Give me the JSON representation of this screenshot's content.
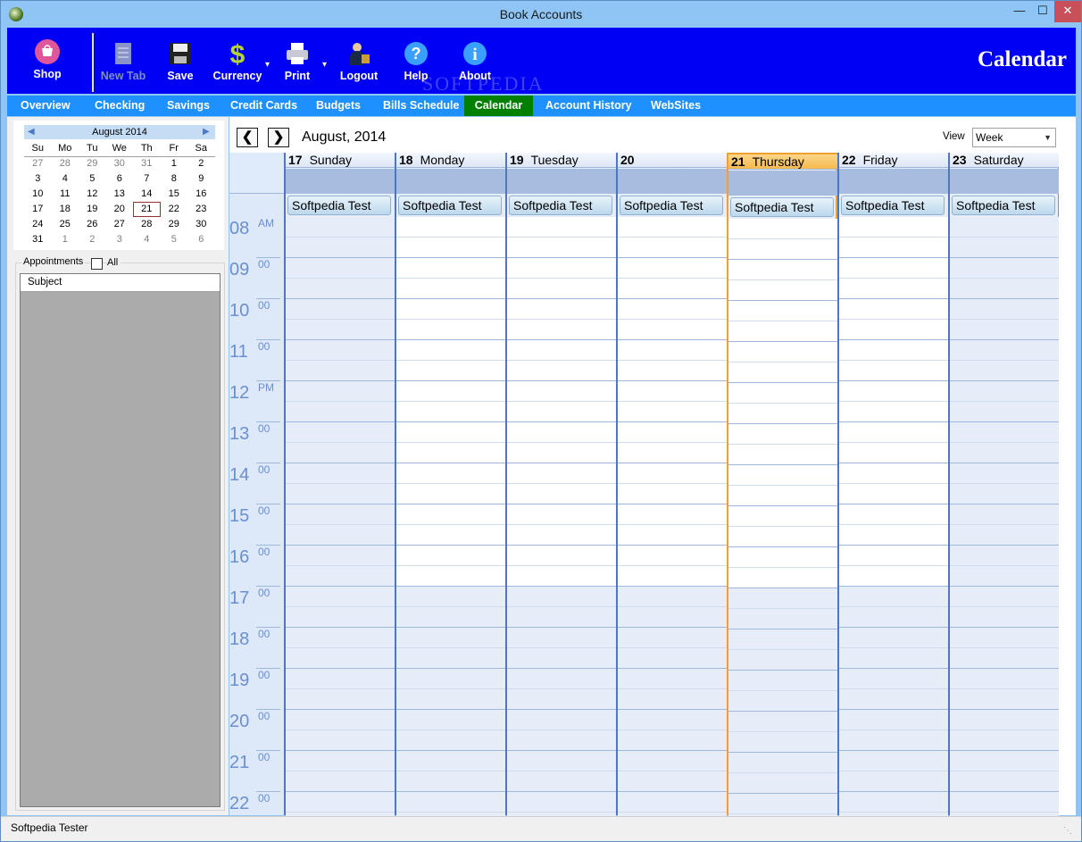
{
  "window": {
    "title": "Book Accounts"
  },
  "toolbar": {
    "items": [
      {
        "label": "Shop",
        "icon": "shop-icon"
      },
      {
        "label": "New Tab",
        "icon": "new-tab-icon",
        "disabled": true
      },
      {
        "label": "Save",
        "icon": "save-disk-icon"
      },
      {
        "label": "Currency",
        "icon": "dollar-sign-icon"
      },
      {
        "label": "Print",
        "icon": "printer-icon"
      },
      {
        "label": "Logout",
        "icon": "logout-person-icon"
      },
      {
        "label": "Help",
        "icon": "help-question-icon"
      },
      {
        "label": "About",
        "icon": "about-info-icon"
      }
    ],
    "heading": "Calendar",
    "watermark": "SOFTPEDIA"
  },
  "nav": {
    "items": [
      "Overview",
      "Checking",
      "Savings",
      "Credit Cards",
      "Budgets",
      "Bills Schedule",
      "Calendar",
      "Account History",
      "WebSites"
    ],
    "active": "Calendar"
  },
  "mini_calendar": {
    "month": "August 2014",
    "weekdays": [
      "Su",
      "Mo",
      "Tu",
      "We",
      "Th",
      "Fr",
      "Sa"
    ],
    "weeks": [
      [
        "27",
        "28",
        "29",
        "30",
        "31",
        "1",
        "2"
      ],
      [
        "3",
        "4",
        "5",
        "6",
        "7",
        "8",
        "9"
      ],
      [
        "10",
        "11",
        "12",
        "13",
        "14",
        "15",
        "16"
      ],
      [
        "17",
        "18",
        "19",
        "20",
        "21",
        "22",
        "23"
      ],
      [
        "24",
        "25",
        "26",
        "27",
        "28",
        "29",
        "30"
      ],
      [
        "31",
        "1",
        "2",
        "3",
        "4",
        "5",
        "6"
      ]
    ],
    "selected": "21"
  },
  "appointments": {
    "label": "Appointments",
    "all_label": "All",
    "column": "Subject"
  },
  "calendar": {
    "month_title": "August, 2014",
    "view_label": "View",
    "view_value": "Week",
    "days": [
      {
        "num": "17",
        "name": "Sunday",
        "event": "Softpedia Test"
      },
      {
        "num": "18",
        "name": "Monday",
        "event": "Softpedia Test"
      },
      {
        "num": "19",
        "name": "Tuesday",
        "event": "Softpedia Test"
      },
      {
        "num": "20",
        "name": "",
        "event": "Softpedia Test"
      },
      {
        "num": "21",
        "name": "Thursday",
        "event": "Softpedia Test"
      },
      {
        "num": "22",
        "name": "Friday",
        "event": "Softpedia Test"
      },
      {
        "num": "23",
        "name": "Saturday",
        "event": "Softpedia Test"
      }
    ],
    "hours": [
      {
        "h": "08",
        "m": "AM"
      },
      {
        "h": "09",
        "m": "00"
      },
      {
        "h": "10",
        "m": "00"
      },
      {
        "h": "11",
        "m": "00"
      },
      {
        "h": "12",
        "m": "PM"
      },
      {
        "h": "13",
        "m": "00"
      },
      {
        "h": "14",
        "m": "00"
      },
      {
        "h": "15",
        "m": "00"
      },
      {
        "h": "16",
        "m": "00"
      },
      {
        "h": "17",
        "m": "00"
      },
      {
        "h": "18",
        "m": "00"
      },
      {
        "h": "19",
        "m": "00"
      },
      {
        "h": "20",
        "m": "00"
      },
      {
        "h": "21",
        "m": "00"
      },
      {
        "h": "22",
        "m": "00"
      }
    ]
  },
  "status": {
    "text": "Softpedia Tester"
  }
}
